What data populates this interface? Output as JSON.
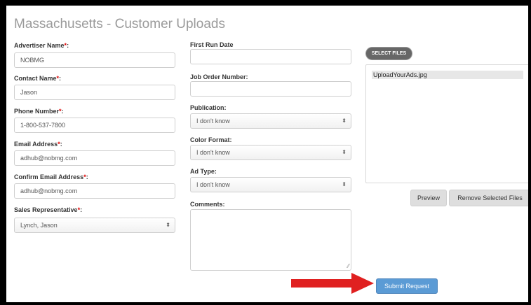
{
  "page": {
    "title": "Massachusetts - Customer Uploads"
  },
  "required_marker": "*",
  "left": {
    "advertiser_name": {
      "label": "Advertiser Name",
      "value": "NOBMG"
    },
    "contact_name": {
      "label": "Contact Name",
      "value": "Jason"
    },
    "phone_number": {
      "label": "Phone Number",
      "value": "1-800-537-7800"
    },
    "email_address": {
      "label": "Email Address",
      "value": "adhub@nobmg.com"
    },
    "confirm_email": {
      "label": "Confirm Email Address",
      "value": "adhub@nobmg.com"
    },
    "sales_rep": {
      "label": "Sales Representative",
      "value": "Lynch, Jason"
    }
  },
  "middle": {
    "first_run_date": {
      "label": "First Run Date",
      "value": ""
    },
    "job_order_number": {
      "label": "Job Order Number:",
      "value": ""
    },
    "publication": {
      "label": "Publication:",
      "value": "I don't know"
    },
    "color_format": {
      "label": "Color Format:",
      "value": "I don't know"
    },
    "ad_type": {
      "label": "Ad Type:",
      "value": "I don't know"
    },
    "comments": {
      "label": "Comments:",
      "value": ""
    }
  },
  "files": {
    "select_label": "SELECT FILES",
    "items": [
      "UploadYourAds.jpg"
    ],
    "preview_label": "Preview",
    "remove_label": "Remove Selected Files"
  },
  "submit_label": "Submit Request",
  "colors": {
    "arrow": "#e02020",
    "submit": "#5b9bd5",
    "required": "#dd0000"
  },
  "select_arrow_glyph": "⬍"
}
